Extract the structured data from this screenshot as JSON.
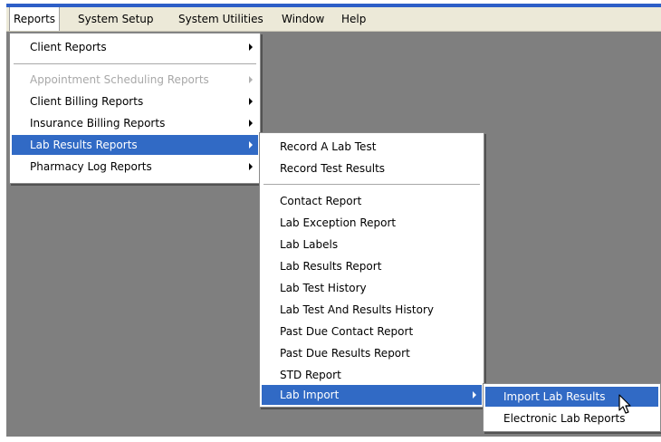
{
  "menubar": {
    "items": [
      "Reports",
      "System Setup",
      "System Utilities",
      "Window",
      "Help"
    ]
  },
  "reports_menu": {
    "items": [
      {
        "label": "Client Reports",
        "submenu": true,
        "disabled": false
      },
      {
        "label": "Appointment Scheduling Reports",
        "submenu": true,
        "disabled": true
      },
      {
        "label": "Client Billing Reports",
        "submenu": true,
        "disabled": false
      },
      {
        "label": "Insurance Billing Reports",
        "submenu": true,
        "disabled": false
      },
      {
        "label": "Lab Results Reports",
        "submenu": true,
        "disabled": false,
        "selected": true
      },
      {
        "label": "Pharmacy Log Reports",
        "submenu": true,
        "disabled": false
      }
    ]
  },
  "lab_results_menu": {
    "items": [
      {
        "label": "Record A Lab Test"
      },
      {
        "label": "Record Test Results"
      },
      {
        "label": "Contact Report"
      },
      {
        "label": "Lab Exception Report"
      },
      {
        "label": "Lab Labels"
      },
      {
        "label": "Lab Results Report"
      },
      {
        "label": "Lab Test History"
      },
      {
        "label": "Lab Test And Results History"
      },
      {
        "label": "Past Due Contact Report"
      },
      {
        "label": "Past Due Results Report"
      },
      {
        "label": "STD Report"
      },
      {
        "label": "Lab Import",
        "submenu": true,
        "selected": true
      }
    ]
  },
  "lab_import_menu": {
    "items": [
      {
        "label": "Import Lab Results",
        "selected": true
      },
      {
        "label": "Electronic Lab Reports"
      }
    ]
  },
  "colors": {
    "highlight": "#316ac5",
    "menubar": "#ece9d8",
    "workspace": "#7f7f7f"
  },
  "icons": {
    "cursor": "mouse-pointer-icon",
    "submenu": "submenu-arrow-icon"
  }
}
